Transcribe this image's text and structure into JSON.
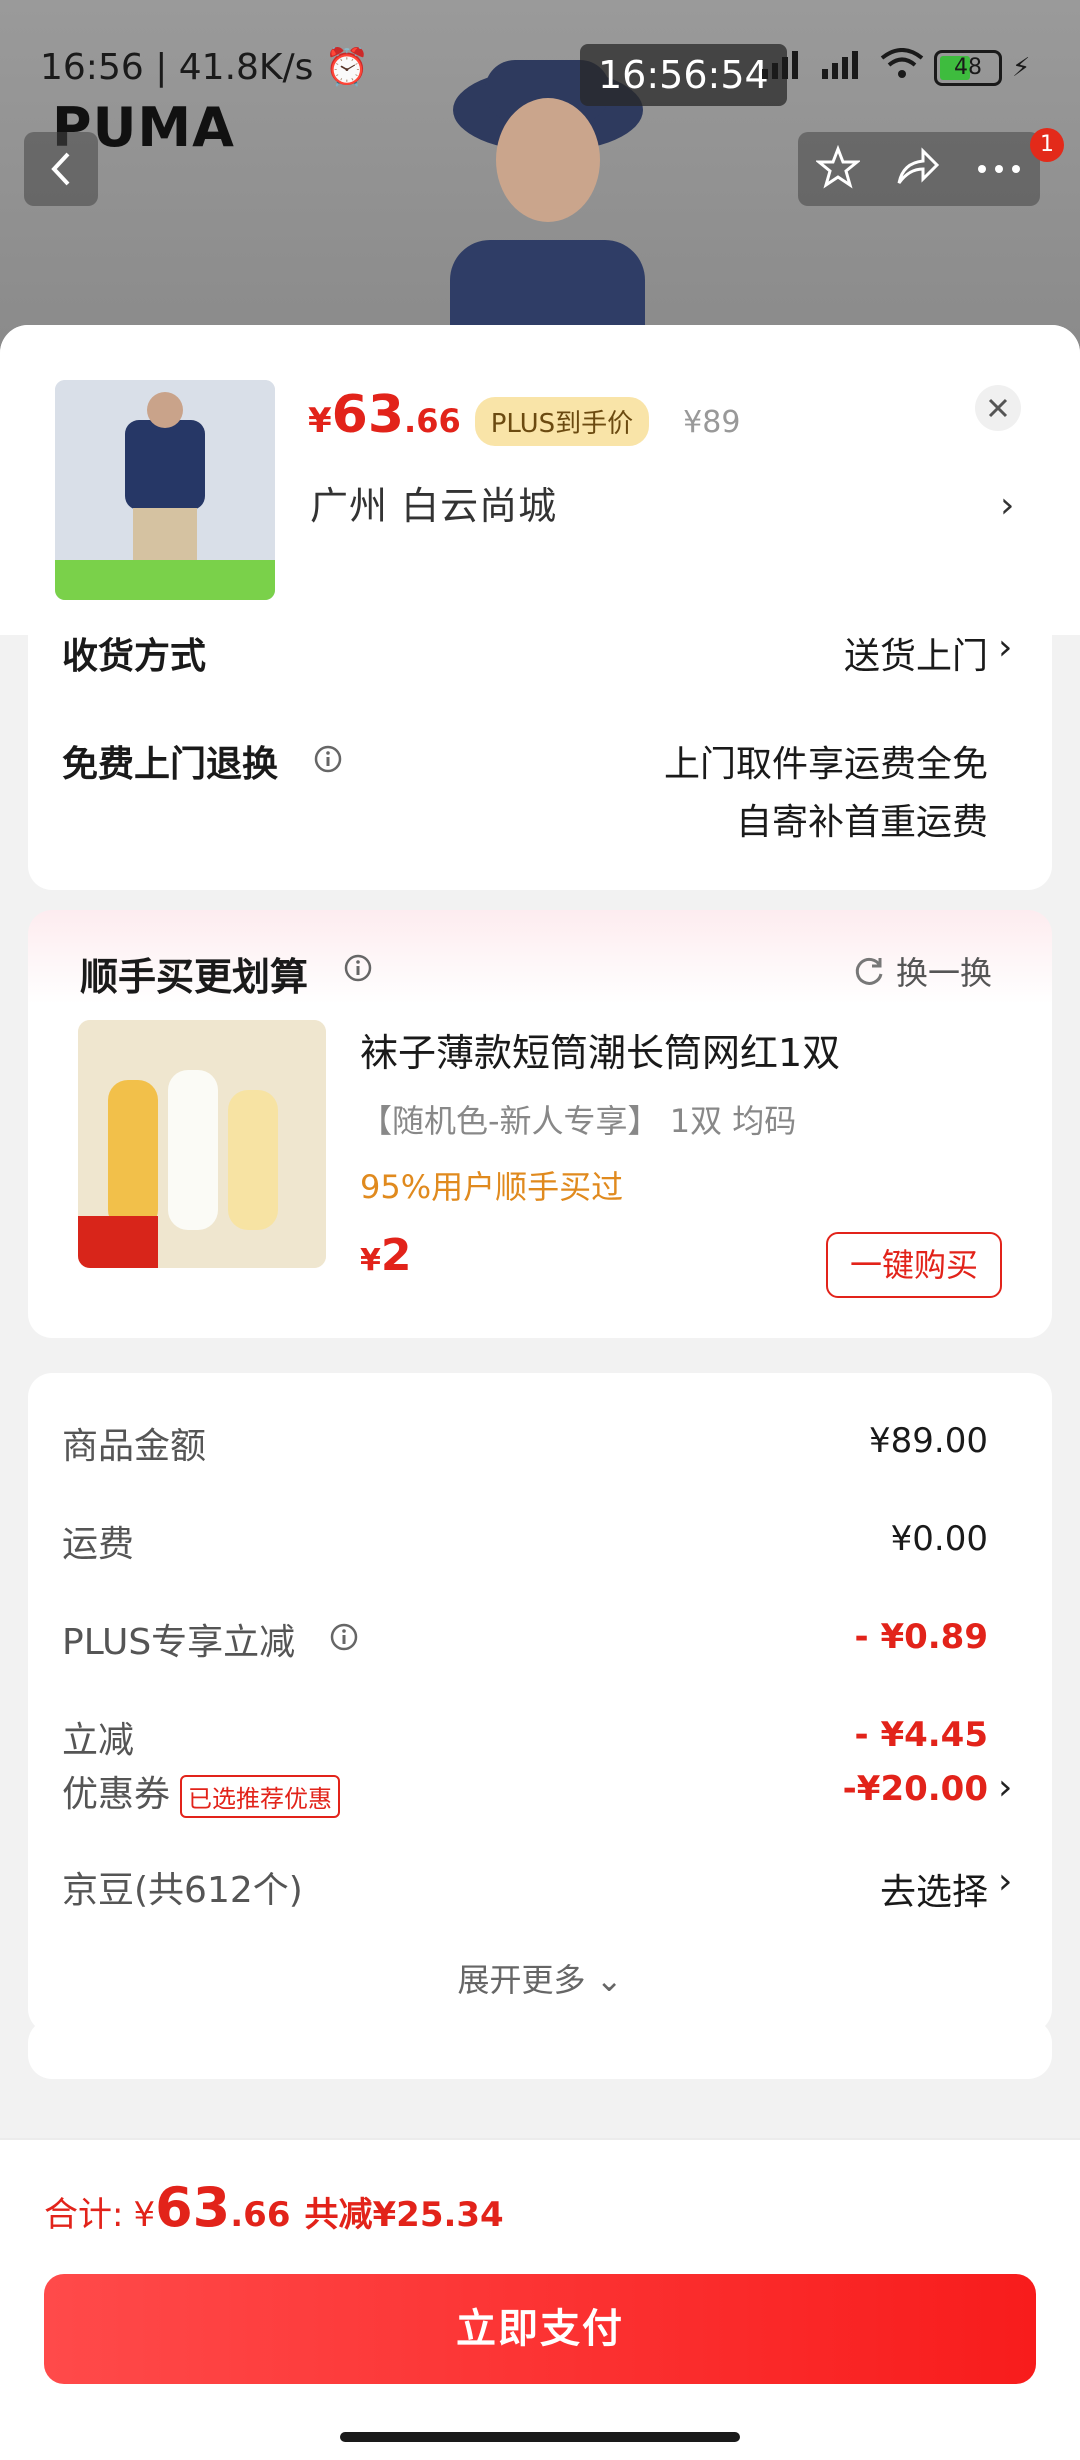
{
  "status": {
    "time": "16:56",
    "net_speed": "41.8K/s",
    "center_time": "16:56:54",
    "battery": "48"
  },
  "brand": {
    "logo_text": "PUMA"
  },
  "nav": {
    "badge_count": "1"
  },
  "product": {
    "price_symbol": "¥",
    "price_int": "63",
    "price_dec": ".66",
    "plus_label": "PLUS到手价",
    "original_price": "¥89",
    "address": "广州  白云尚城"
  },
  "delivery": {
    "method_label": "收货方式",
    "method_value": "送货上门",
    "return_label": "免费上门退换",
    "return_line1": "上门取件享运费全免",
    "return_line2": "自寄补首重运费"
  },
  "bundle": {
    "title": "顺手买更划算",
    "swap_label": "换一换",
    "item_name": "袜子薄款短筒潮长筒网红1双",
    "item_spec": "【随机色-新人专享】 1双   均码",
    "item_stat": "95%用户顺手买过",
    "price_symbol": "¥",
    "price": "2",
    "buy_label": "一键购买"
  },
  "summary": {
    "rows": [
      {
        "label": "商品金额",
        "value": "¥89.00"
      },
      {
        "label": "运费",
        "value": "¥0.00"
      },
      {
        "label": "PLUS专享立减",
        "value": "- ¥0.89"
      },
      {
        "label": "立减",
        "value": "- ¥4.45"
      },
      {
        "label": "优惠券",
        "tag": "已选推荐优惠",
        "value": "-¥20.00"
      },
      {
        "label": "京豆(共612个)",
        "value": "去选择"
      }
    ],
    "expand_label": "展开更多"
  },
  "footer": {
    "total_label": "合计:",
    "total_symbol": "¥",
    "total_int": "63",
    "total_dec": ".66",
    "saved": "共减¥25.34",
    "pay_label": "立即支付"
  },
  "colors": {
    "accent": "#e2231a",
    "plus_tag_bg": "#f9e4a8"
  }
}
